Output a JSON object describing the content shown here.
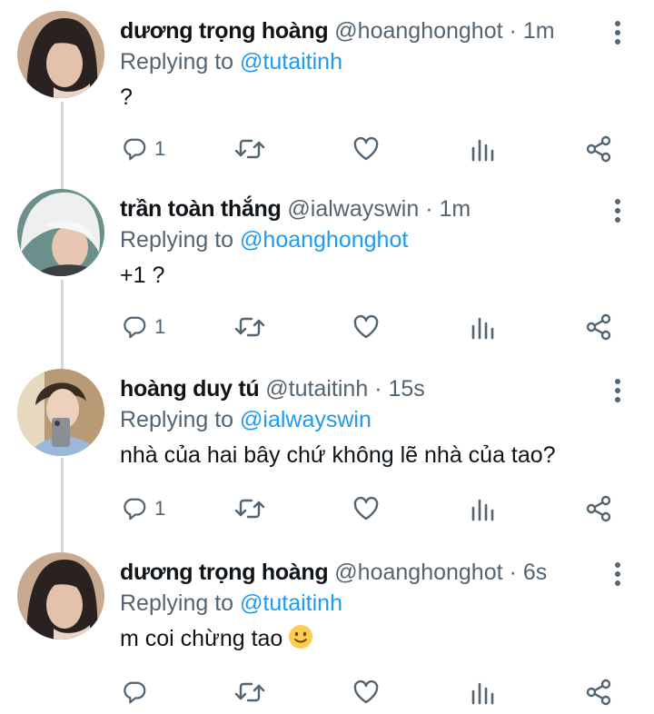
{
  "tweets": [
    {
      "name": "dương trọng hoàng",
      "handle": "@hoanghonghot",
      "separator": "·",
      "time": "1m",
      "replying_label": "Replying to",
      "replying_to": "@tutaitinh",
      "text": "?",
      "reply_count": "1",
      "avatar": "avatar-dark-hair"
    },
    {
      "name": "trần toàn thắng",
      "handle": "@ialwayswin",
      "separator": "·",
      "time": "1m",
      "replying_label": "Replying to",
      "replying_to": "@hoanghonghot",
      "text": "+1 ?",
      "reply_count": "1",
      "avatar": "avatar-white-hair"
    },
    {
      "name": "hoàng duy tú",
      "handle": "@tutaitinh",
      "separator": "·",
      "time": "15s",
      "replying_label": "Replying to",
      "replying_to": "@ialwayswin",
      "text": "nhà của hai bây chứ không lẽ nhà của tao?",
      "reply_count": "1",
      "avatar": "avatar-selfie"
    },
    {
      "name": "dương trọng hoàng",
      "handle": "@hoanghonghot",
      "separator": "·",
      "time": "6s",
      "replying_label": "Replying to",
      "replying_to": "@tutaitinh",
      "text": "m coi chừng tao",
      "reply_count": "",
      "avatar": "avatar-dark-hair"
    }
  ],
  "colors": {
    "link": "#1d9bf0",
    "secondary_text": "#536471",
    "icon": "#536471",
    "thread_line": "#cfd9de"
  },
  "icons": [
    "reply-icon",
    "retweet-icon",
    "like-icon",
    "views-icon",
    "share-icon",
    "more-icon",
    "smile-emoji-icon"
  ]
}
